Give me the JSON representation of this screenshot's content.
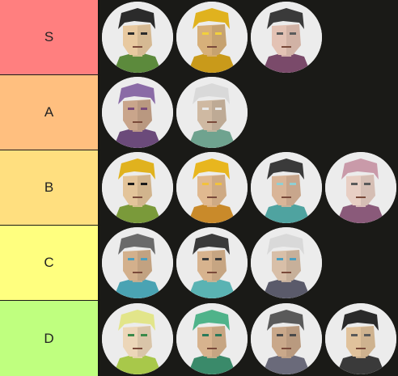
{
  "tiers": [
    {
      "label": "S",
      "color": "#ff7f7f",
      "items": [
        {
          "name": "dark-haired-man-green-shirt-avatar",
          "hair": "#2b2b2b",
          "skin": "#e8c9a0",
          "shirt": "#5c8a3c",
          "accent": "#2b2b2b"
        },
        {
          "name": "yellow-hat-goggles-avatar",
          "hair": "#e0b21e",
          "skin": "#d7b07a",
          "shirt": "#c99a1a",
          "accent": "#f2d13c"
        },
        {
          "name": "dark-hair-glasses-woman-avatar",
          "hair": "#3a3a3a",
          "skin": "#e3c2b4",
          "shirt": "#7a4a6a",
          "accent": "#5b5b5b"
        }
      ]
    },
    {
      "label": "A",
      "color": "#ffbf7f",
      "items": [
        {
          "name": "purple-hair-mustache-man-avatar",
          "hair": "#8a6ba6",
          "skin": "#c9a58b",
          "shirt": "#6b4a7a",
          "accent": "#7a4a7a"
        },
        {
          "name": "white-haired-bearded-elder-avatar",
          "hair": "#d9d9d9",
          "skin": "#cfb9a2",
          "shirt": "#6fa38f",
          "accent": "#e8e8e8"
        }
      ]
    },
    {
      "label": "B",
      "color": "#ffdf7f",
      "items": [
        {
          "name": "blond-sunglasses-man-avatar",
          "hair": "#e0b21e",
          "skin": "#e3c49a",
          "shirt": "#7a9a3a",
          "accent": "#1a1a1a"
        },
        {
          "name": "spiky-blond-hair-kid-avatar",
          "hair": "#e8b61e",
          "skin": "#e0b990",
          "shirt": "#c98a2a",
          "accent": "#f2c23c"
        },
        {
          "name": "nurse-cap-woman-avatar",
          "hair": "#3a3a3a",
          "skin": "#d9b598",
          "shirt": "#4fa3a0",
          "accent": "#8fcfd3"
        },
        {
          "name": "pink-hair-glasses-woman-avatar",
          "hair": "#c99aa9",
          "skin": "#e8cfc4",
          "shirt": "#8a5a7a",
          "accent": "#5a5a5a"
        }
      ]
    },
    {
      "label": "C",
      "color": "#ffff7f",
      "items": [
        {
          "name": "grey-hair-blue-glasses-man-avatar",
          "hair": "#6a6a6a",
          "skin": "#d3b08c",
          "shirt": "#4aa3b3",
          "accent": "#4a9fc0"
        },
        {
          "name": "dark-hair-smiling-man-avatar",
          "hair": "#3a3a3a",
          "skin": "#d7b38e",
          "shirt": "#5ab3b3",
          "accent": "#3a3a3a"
        },
        {
          "name": "white-hair-blue-glasses-elder-avatar",
          "hair": "#d9d9d9",
          "skin": "#d8bfa8",
          "shirt": "#5a5a6a",
          "accent": "#4a9fc0"
        }
      ]
    },
    {
      "label": "D",
      "color": "#bfff7f",
      "items": [
        {
          "name": "green-flower-hair-woman-avatar",
          "hair": "#e2e58a",
          "skin": "#ecd6b8",
          "shirt": "#a8c84a",
          "accent": "#3a8a4a"
        },
        {
          "name": "green-hair-smiling-woman-avatar",
          "hair": "#4fb38a",
          "skin": "#d7b38e",
          "shirt": "#3a8a6a",
          "accent": "#2a7a5a"
        },
        {
          "name": "grey-hair-man-avatar",
          "hair": "#5a5a5a",
          "skin": "#c9a88a",
          "shirt": "#6a6a7a",
          "accent": "#4a4a4a"
        },
        {
          "name": "black-hat-woman-avatar",
          "hair": "#2a2a2a",
          "skin": "#e0c29c",
          "shirt": "#3a3a3a",
          "accent": "#5a5a5a"
        }
      ]
    }
  ]
}
